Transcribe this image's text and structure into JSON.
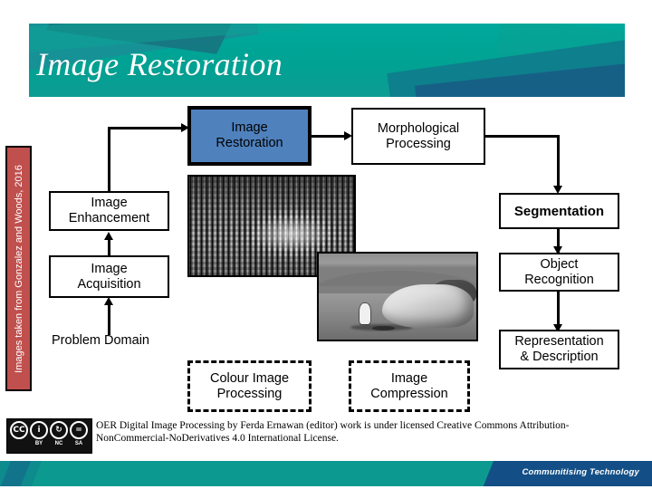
{
  "slide": {
    "title": "Image Restoration",
    "attribution_vertical": "Images taken from Gonzalez and Woods, 2016"
  },
  "colors": {
    "banner_teal": "#00a99c",
    "banner_dark_teal": "#17747f",
    "banner_blue": "#175f86",
    "attribution_red": "#c0504d",
    "accent_box_blue": "#4f81bd",
    "footer_teal": "#0c9a90",
    "footer_navy": "#134f86",
    "outline_black": "#000000"
  },
  "diagram": {
    "boxes": [
      {
        "id": "image-restoration",
        "label": "Image\nRestoration",
        "line1": "Image",
        "line2": "Restoration",
        "style": "filled-blue"
      },
      {
        "id": "morphological",
        "label": "Morphological\nProcessing",
        "line1": "Morphological",
        "line2": "Processing",
        "style": "outline"
      },
      {
        "id": "image-enhancement",
        "label": "Image\nEnhancement",
        "line1": "Image",
        "line2": "Enhancement",
        "style": "outline"
      },
      {
        "id": "image-acquisition",
        "label": "Image\nAcquisition",
        "line1": "Image",
        "line2": "Acquisition",
        "style": "outline"
      },
      {
        "id": "segmentation",
        "label": "Segmentation",
        "line1": "Segmentation",
        "line2": "",
        "style": "outline-bold"
      },
      {
        "id": "object-recognition",
        "label": "Object\nRecognition",
        "line1": "Object",
        "line2": "Recognition",
        "style": "outline"
      },
      {
        "id": "representation",
        "label": "Representation\n& Description",
        "line1": "Representation",
        "line2": "& Description",
        "style": "outline"
      },
      {
        "id": "colour-image",
        "label": "Colour Image\nProcessing",
        "line1": "Colour Image",
        "line2": "Processing",
        "style": "dashed"
      },
      {
        "id": "image-compression",
        "label": "Image\nCompression",
        "line1": "Image",
        "line2": "Compression",
        "style": "dashed"
      }
    ],
    "problem_domain_label": "Problem Domain"
  },
  "images": {
    "noisy": "degraded-noisy-image-sample",
    "moon": "lunar-surface-astronaut-photo"
  },
  "license": {
    "badge_icons": [
      {
        "glyph": "CC",
        "sub": ""
      },
      {
        "glyph": "i",
        "sub": "BY"
      },
      {
        "glyph": "↻",
        "sub": "NC"
      },
      {
        "glyph": "=",
        "sub": "SA"
      }
    ],
    "text": "OER Digital Image Processing by Ferda Ernawan (editor) work is under licensed Creative Commons Attribution-NonCommercial-NoDerivatives 4.0 International License."
  },
  "footer": {
    "tagline": "Communitising Technology"
  }
}
